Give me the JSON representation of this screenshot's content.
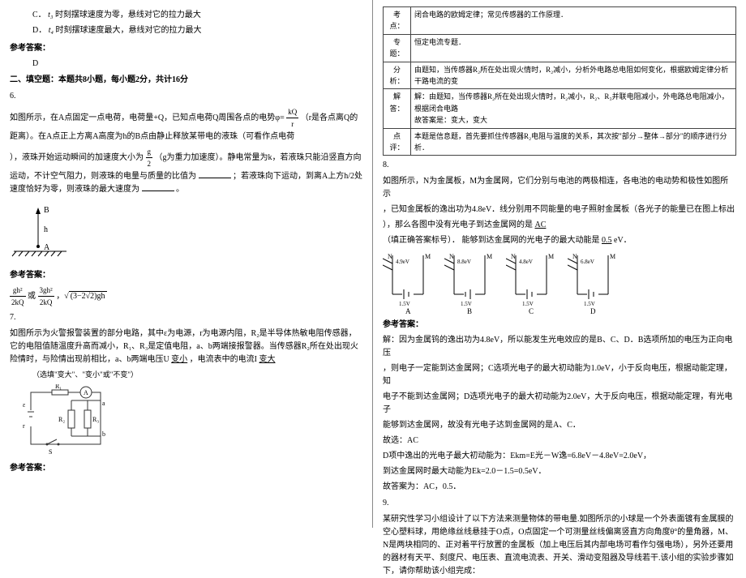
{
  "left": {
    "optC": "C．",
    "optC_text": "时刻摆球速度为零，悬线对它的拉力最大",
    "optD": "D．",
    "optD_text": "时刻摆球速度最大，悬线对它的拉力最大",
    "ref_ans": "参考答案：",
    "ans5": "D",
    "section2": "二、填空题：本题共8小题，每小题2分，共计16分",
    "q6": "6.",
    "q6_p1a": "如图所示，在A点固定一点电荷，电荷量+Q，已知点电荷Q周围各点的电势φ=",
    "q6_p1b": "（r是各点离Q的距离）。在A点正上方离A高度为h的B点由静止释放某带电的液珠（可看作点电荷",
    "q6_p2a": "），液珠开始运动瞬间的加速度大小为",
    "q6_p2b": "（g为重力加速度）。静电常量为k，若液珠只能沿竖直方向运动，不计空气阻力，则液珠的电量与质量的比值为",
    "q6_p2c": "；若液珠向下运动，到离A上方h/2处速度恰好为零，则液珠的最大速度为",
    "q6_p2d": "。",
    "figA": "A",
    "figB": "B",
    "figh": "h",
    "ref_ans2": "参考答案：",
    "ans6a_num": "gh²",
    "ans6a_den": "2kQ",
    "ans6a_or": "或",
    "ans6b_num": "3gh²",
    "ans6b_den": "2kQ",
    "ans6c": "(3−2√2)gh",
    "q7": "7.",
    "q7_p1": "如图所示为火警报警装置的部分电路，其中ε为电源，r为电源内阻，R₂是半导体热敏电阻传感器，它的电阻值随温度升高而减小，R₁、R₃是定值电阻，a、b两端接报警器。当传感器R₂所在处出现火险情时，与险情出现前相比，a、b两端电压U",
    "q7_blank1": "变小",
    "q7_p2": "，电流表中的电流I",
    "q7_blank2": "变大",
    "q7_hint": "（选填\"变大\"、\"变小\"或\"不变\"）",
    "ref_ans3": "参考答案：",
    "circ_eps": "ε",
    "circ_r": "r",
    "circ_R1": "R₁",
    "circ_R2": "R₂",
    "circ_R3": "R₃",
    "circ_S": "S",
    "circ_a": "a",
    "circ_b": "b",
    "circ_A": "A"
  },
  "right": {
    "tab_kd": "考点：",
    "tab_kd_v": "闭合电路的欧姆定律；常见传感器的工作原理．",
    "tab_zt": "专题：",
    "tab_zt_v": "恒定电流专题．",
    "tab_fx": "分析：",
    "tab_fx_v": "由题知，当传感器R₂所在处出现火情时，R₂减小，分析外电路总电阻如何变化，根据欧姆定律分析干路电流的变",
    "tab_jd": "解答：",
    "tab_jd_v1": "解：由题知，当传感器R₂所在处出现火情时，R₂减小，R₂、R₃并联电阻减小，外电路总电阻减小，根据闭合电路",
    "tab_jd_v2": "故答案是：变大，变大",
    "tab_dp": "点评：",
    "tab_dp_v": "本题是信息题，首先要抓住传感器R₂电阻与温度的关系，其次按\"部分→整体→部分\"的顺序进行分析．",
    "q8": "8.",
    "q8_p1": "如图所示，N为金属板，M为金属网，它们分别与电池的两极相连，各电池的电动势和极性如图所示",
    "q8_p2": "，已知金属板的逸出功为4.8eV．线分别用不同能量的电子照射金属板（各光子的能量已在图上标出",
    "q8_p3": "），那么各图中没有光电子到达金属网的是",
    "q8_ans1": "AC",
    "q8_p4a": "（填正确答案标号）．",
    "q8_p4b": "能够到达金属网的光电子的最大动能是",
    "q8_ans2": "0.5",
    "q8_p4c": " eV．",
    "dlabelN": "N",
    "dlabelM": "M",
    "dA_e": "4.9eV",
    "dA_v": "1.5V",
    "dA_cap": "A",
    "dB_e": "8.8eV",
    "dB_v": "1.5V",
    "dB_cap": "B",
    "dC_e": "4.8eV",
    "dC_v": "1.5V",
    "dC_cap": "C",
    "dD_e": "6.8eV",
    "dD_v": "1.5V",
    "dD_cap": "D",
    "ref_ans4": "参考答案：",
    "sol_p1": "解：因为金属钨的逸出功为4.8eV，所以能发生光电效应的是B、C、D．B选项所加的电压为正向电压",
    "sol_p2": "，则电子一定能到达金属网；C选项光电子的最大初动能为1.0eV，小于反向电压，根据动能定理，知",
    "sol_p3": "电子不能到达金属网；D选项光电子的最大初动能为2.0eV，大于反向电压，根据动能定理，有光电子",
    "sol_p4": "能够到达金属网，故没有光电子达到金属网的是A、C．",
    "sol_p5": "故选：AC",
    "sol_p6": "D项中逸出的光电子最大初动能为：Ekm=E光－W逸=6.8eV－4.8eV=2.0eV，",
    "sol_p7": "到达金属网时最大动能为Ek=2.0－1.5=0.5eV．",
    "sol_p8": "故答案为：AC，0.5．",
    "q9": "9.",
    "q9_p1": "某研究性学习小组设计了以下方法来测量物体的带电量.如图所示的小球是一个外表面镀有金属膜的空心塑料球，用绝缘丝线悬挂于O点，O点固定一个可测量丝线偏离竖直方向角度θ°的量角器，M、N是两块相同的、正对着平行放置的金属板（加上电压后其内部电场可看作匀强电场），另外还要用的器材有天平、刻度尺、电压表、直流电流表、开关、滑动变阻器及导线若干.该小组的实验步骤如下，请你帮助该小组完成："
  }
}
